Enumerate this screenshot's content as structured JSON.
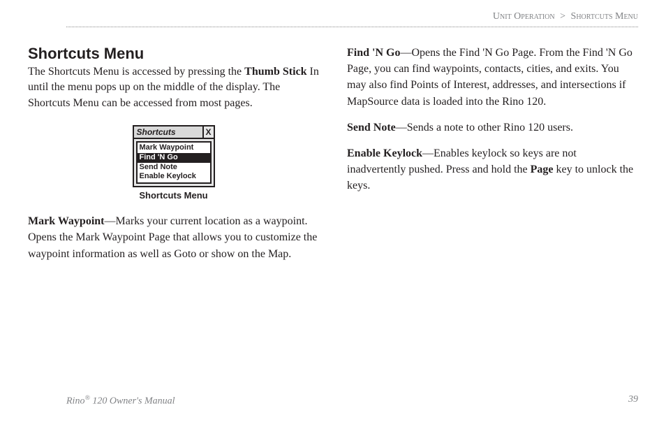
{
  "breadcrumb": {
    "section": "Unit Operation",
    "sep": ">",
    "page": "Shortcuts Menu"
  },
  "title": "Shortcuts Menu",
  "intro": {
    "t1": "The Shortcuts Menu is accessed by pressing the ",
    "bold1": "Thumb Stick",
    "t2": " In until the menu pops up on the middle of the display. The Shortcuts Menu can be accessed from most pages."
  },
  "menu": {
    "title": "Shortcuts",
    "close": "X",
    "items": [
      "Mark Waypoint",
      "Find 'N Go",
      "Send Note",
      "Enable Keylock"
    ],
    "selectedIndex": 1,
    "caption": "Shortcuts Menu"
  },
  "defs": {
    "markWaypoint": {
      "lead": "Mark Waypoint",
      "text": "—Marks your current location as a waypoint. Opens the Mark Waypoint Page that allows you to customize the waypoint information as well as Goto or show on the Map."
    },
    "findNGo": {
      "lead": "Find 'N Go",
      "text": "—Opens the Find 'N Go Page. From the Find 'N Go Page, you can find waypoints, contacts, cities, and exits. You may also find Points of Interest, addresses, and intersections if MapSource data is loaded into the Rino 120."
    },
    "sendNote": {
      "lead": "Send Note",
      "text": "—Sends a note to other Rino 120 users."
    },
    "enableKeylock": {
      "lead": "Enable Keylock",
      "t1": "—Enables keylock so keys are not inadvertently pushed. Press and hold the ",
      "bold": "Page",
      "t2": " key to unlock the keys."
    }
  },
  "footer": {
    "product": "Rino",
    "reg": "®",
    "model": " 120 Owner's Manual",
    "pageNum": "39"
  }
}
